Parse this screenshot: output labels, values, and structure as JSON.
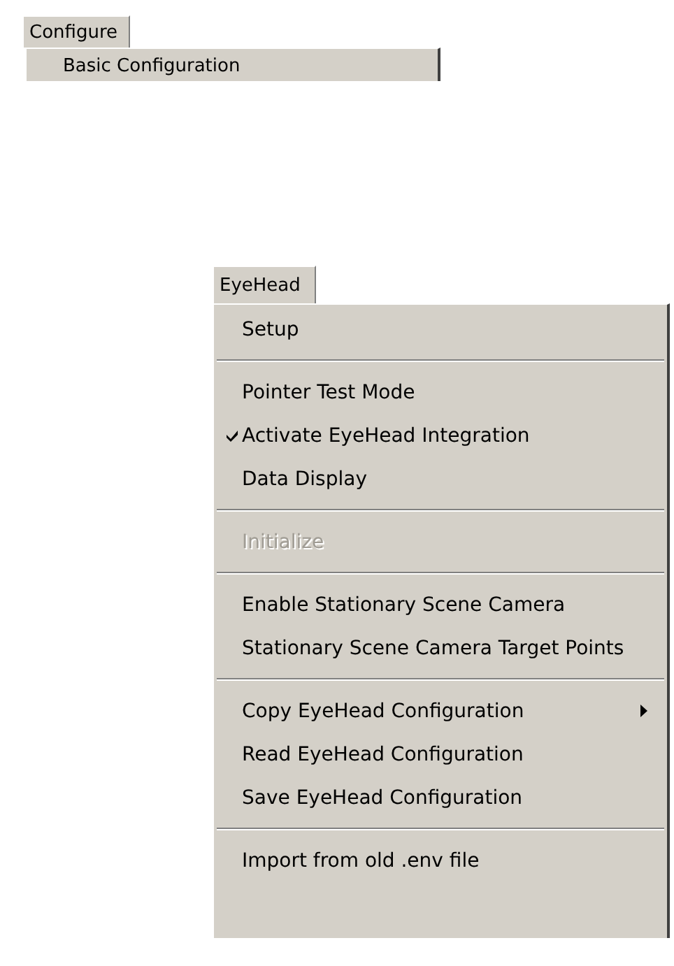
{
  "menus": [
    {
      "title": "Configure",
      "items": [
        {
          "kind": "item",
          "label": "Basic Configuration",
          "checked": false,
          "disabled": false,
          "submenu": false
        }
      ]
    },
    {
      "title": "EyeHead",
      "items": [
        {
          "kind": "item",
          "label": "Setup",
          "checked": false,
          "disabled": false,
          "submenu": false
        },
        {
          "kind": "separator"
        },
        {
          "kind": "item",
          "label": "Pointer Test Mode",
          "checked": false,
          "disabled": false,
          "submenu": false
        },
        {
          "kind": "item",
          "label": "Activate EyeHead Integration",
          "checked": true,
          "disabled": false,
          "submenu": false
        },
        {
          "kind": "item",
          "label": "Data Display",
          "checked": false,
          "disabled": false,
          "submenu": false
        },
        {
          "kind": "separator"
        },
        {
          "kind": "item",
          "label": "Initialize",
          "checked": false,
          "disabled": true,
          "submenu": false
        },
        {
          "kind": "separator"
        },
        {
          "kind": "item",
          "label": "Enable Stationary Scene Camera",
          "checked": false,
          "disabled": false,
          "submenu": false
        },
        {
          "kind": "item",
          "label": "Stationary Scene Camera Target Points",
          "checked": false,
          "disabled": false,
          "submenu": false
        },
        {
          "kind": "separator"
        },
        {
          "kind": "item",
          "label": "Copy EyeHead Configuration",
          "checked": false,
          "disabled": false,
          "submenu": true
        },
        {
          "kind": "item",
          "label": "Read EyeHead Configuration",
          "checked": false,
          "disabled": false,
          "submenu": false
        },
        {
          "kind": "item",
          "label": "Save EyeHead Configuration",
          "checked": false,
          "disabled": false,
          "submenu": false
        },
        {
          "kind": "separator"
        },
        {
          "kind": "item",
          "label": "Import from old .env file",
          "checked": false,
          "disabled": false,
          "submenu": false
        }
      ]
    }
  ]
}
